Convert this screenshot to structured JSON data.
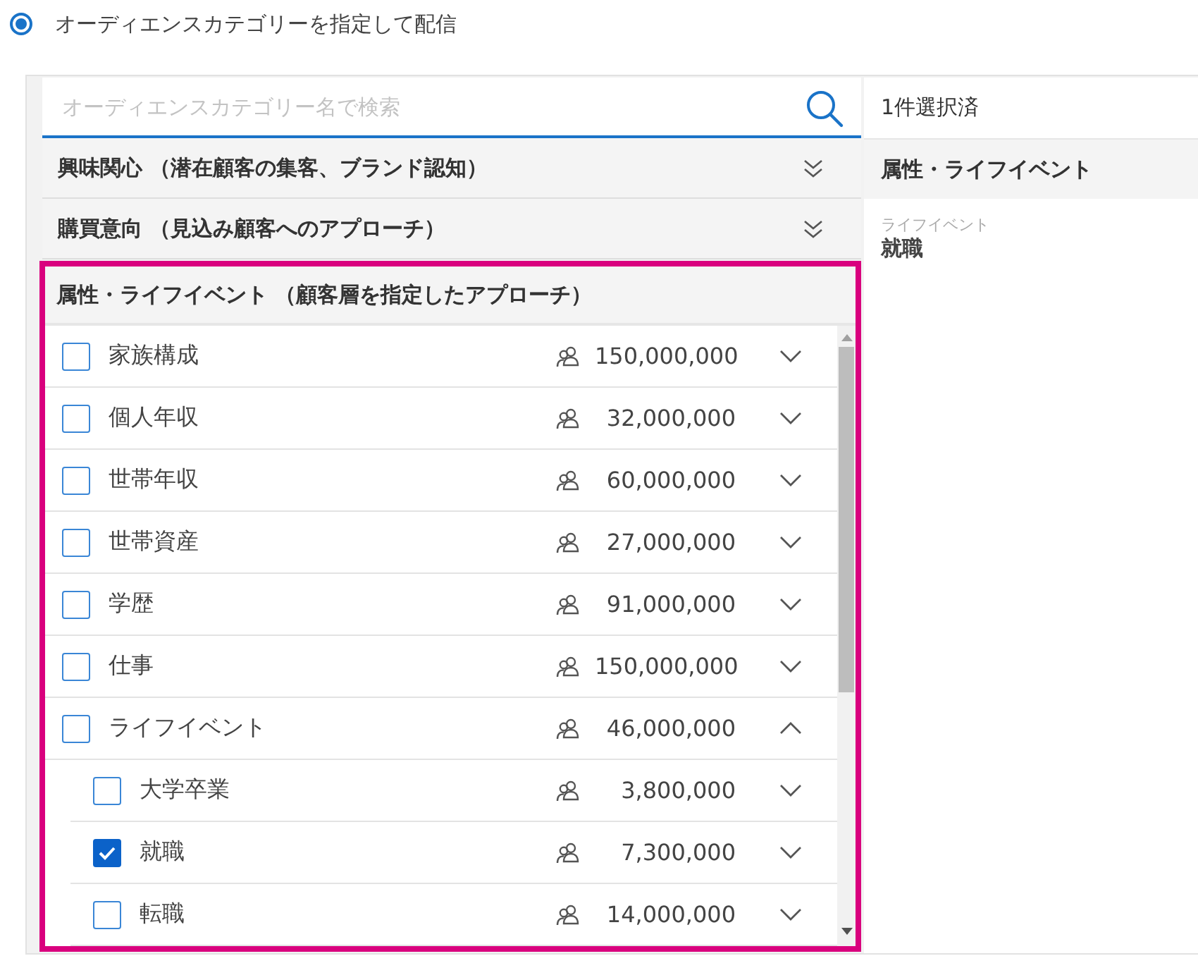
{
  "delivery_option": {
    "label": "オーディエンスカテゴリーを指定して配信",
    "selected": true
  },
  "search": {
    "placeholder": "オーディエンスカテゴリー名で検索"
  },
  "categories": [
    {
      "title": "興味関心 （潜在顧客の集客、ブランド認知）",
      "expanded": false,
      "highlighted": false
    },
    {
      "title": "購買意向 （見込み顧客へのアプローチ）",
      "expanded": false,
      "highlighted": false
    },
    {
      "title": "属性・ライフイベント （顧客層を指定したアプローチ）",
      "expanded": true,
      "highlighted": true,
      "items": [
        {
          "label": "家族構成",
          "count": "150,000,000",
          "checked": false,
          "expanded": false
        },
        {
          "label": "個人年収",
          "count": "32,000,000",
          "checked": false,
          "expanded": false
        },
        {
          "label": "世帯年収",
          "count": "60,000,000",
          "checked": false,
          "expanded": false
        },
        {
          "label": "世帯資産",
          "count": "27,000,000",
          "checked": false,
          "expanded": false
        },
        {
          "label": "学歴",
          "count": "91,000,000",
          "checked": false,
          "expanded": false
        },
        {
          "label": "仕事",
          "count": "150,000,000",
          "checked": false,
          "expanded": false
        },
        {
          "label": "ライフイベント",
          "count": "46,000,000",
          "checked": false,
          "expanded": true,
          "children": [
            {
              "label": "大学卒業",
              "count": "3,800,000",
              "checked": false,
              "expanded": false
            },
            {
              "label": "就職",
              "count": "7,300,000",
              "checked": true,
              "expanded": false
            },
            {
              "label": "転職",
              "count": "14,000,000",
              "checked": false,
              "expanded": false
            }
          ]
        }
      ]
    }
  ],
  "selection_summary": {
    "count": "1件選択済",
    "groups": [
      {
        "title": "属性・ライフイベント",
        "items": [
          {
            "category": "ライフイベント",
            "value": "就職"
          }
        ]
      }
    ]
  }
}
